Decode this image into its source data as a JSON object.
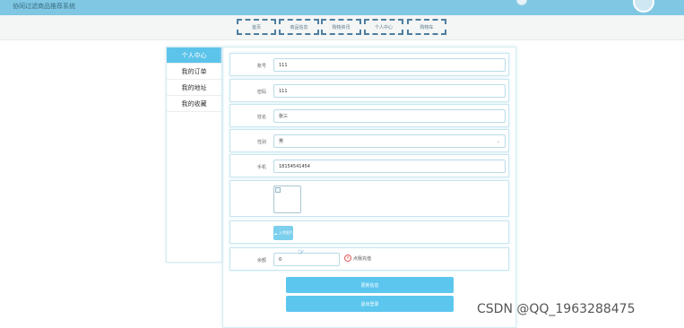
{
  "header": {
    "title": "协同过滤商品推荐系统"
  },
  "nav": {
    "items": [
      "首页",
      "商品信息",
      "购物资讯",
      "个人中心",
      "购物车"
    ]
  },
  "sidebar": {
    "items": [
      "个人中心",
      "我的订单",
      "我的地址",
      "我的收藏"
    ]
  },
  "form": {
    "username_label": "账号",
    "username_value": "111",
    "password_label": "密码",
    "password_value": "111",
    "name_label": "姓名",
    "name_value": "张三",
    "gender_label": "性别",
    "gender_value": "男",
    "phone_label": "手机",
    "phone_value": "18154541454",
    "upload_label": "上传图片",
    "balance_label": "余额",
    "balance_value": "0",
    "recharge_label": "点我充值"
  },
  "actions": {
    "update_label": "更新信息",
    "logout_label": "退出登录"
  },
  "watermark": "CSDN @QQ_1963288475"
}
